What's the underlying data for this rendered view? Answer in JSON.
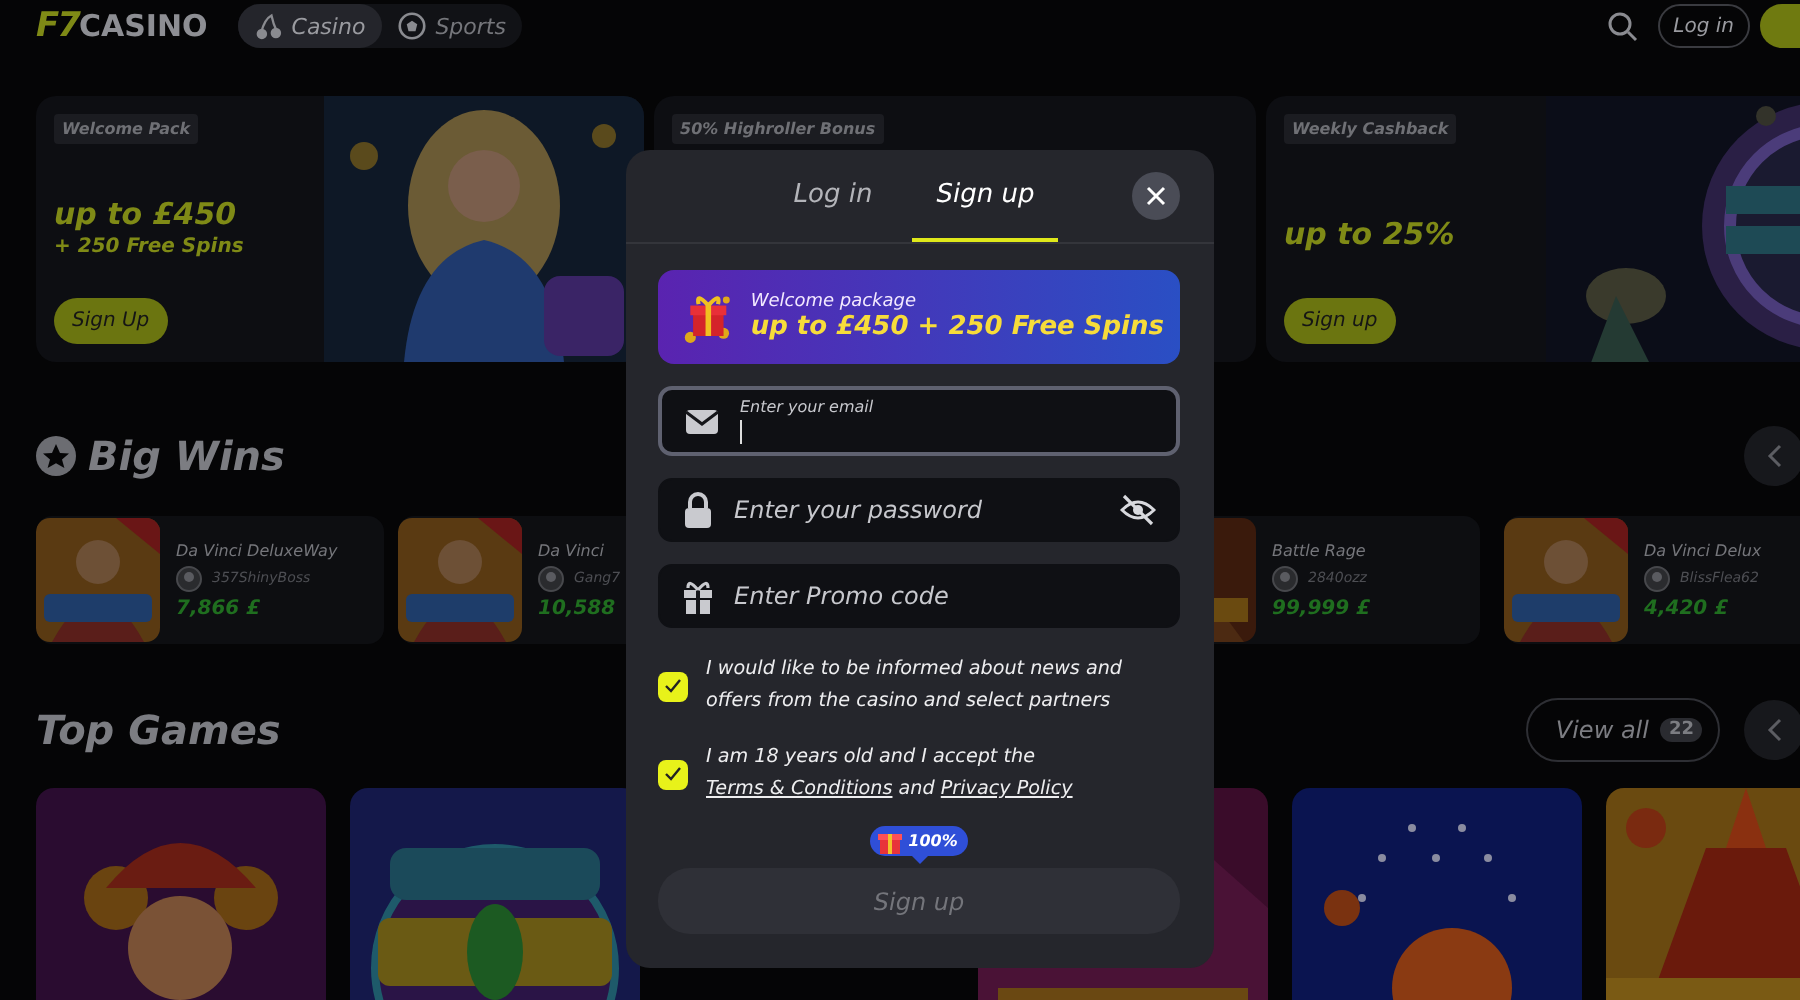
{
  "header": {
    "logo": {
      "mark": "F7",
      "name": "CASINO"
    },
    "nav": [
      {
        "label": "Casino",
        "selected": true
      },
      {
        "label": "Sports",
        "selected": false
      }
    ],
    "login_button": "Log in"
  },
  "promos": [
    {
      "tag": "Welcome Pack",
      "headline": "up to £450",
      "subline": "+ 250 Free Spins",
      "button": "Sign Up"
    },
    {
      "tag": "50% Highroller Bonus"
    },
    {
      "tag": "Weekly Cashback",
      "headline": "up to 25%",
      "button": "Sign up"
    }
  ],
  "big_wins": {
    "title": "Big Wins",
    "cards": [
      {
        "game": "Da Vinci DeluxeWay",
        "player": "357ShinyBoss",
        "amount": "7,866 £"
      },
      {
        "game": "Da Vinci",
        "player": "Gang7",
        "amount": "10,588"
      },
      {
        "game": "Battle Rage",
        "player": "2840ozz",
        "amount": "99,999 £"
      },
      {
        "game": "Da Vinci Delux",
        "player": "BlissFlea62",
        "amount": "4,420 £"
      }
    ]
  },
  "top_games": {
    "title": "Top Games",
    "view_all": "View all",
    "count": "22"
  },
  "modal": {
    "tabs": [
      {
        "label": "Log in",
        "selected": false
      },
      {
        "label": "Sign up",
        "selected": true
      }
    ],
    "banner": {
      "title": "Welcome package",
      "offer": "up to £450 + 250 Free Spins"
    },
    "fields": [
      {
        "kind": "email",
        "label": "Enter your email",
        "focused": true
      },
      {
        "kind": "password",
        "placeholder": "Enter your password"
      },
      {
        "kind": "promo",
        "placeholder": "Enter Promo code"
      }
    ],
    "consents": [
      {
        "checked": true,
        "parts": [
          {
            "kind": "text",
            "text": "I would like to be informed about news and offers from the casino and select partners"
          }
        ]
      },
      {
        "checked": true,
        "parts": [
          {
            "kind": "text",
            "text": "I am 18 years old and I accept the "
          },
          {
            "kind": "link",
            "text": "Terms & Conditions"
          },
          {
            "kind": "text",
            "text": " and "
          },
          {
            "kind": "link",
            "text": "Privacy Policy"
          }
        ]
      }
    ],
    "progress_badge": "100%",
    "submit": {
      "label": "Sign up",
      "disabled": true
    }
  }
}
